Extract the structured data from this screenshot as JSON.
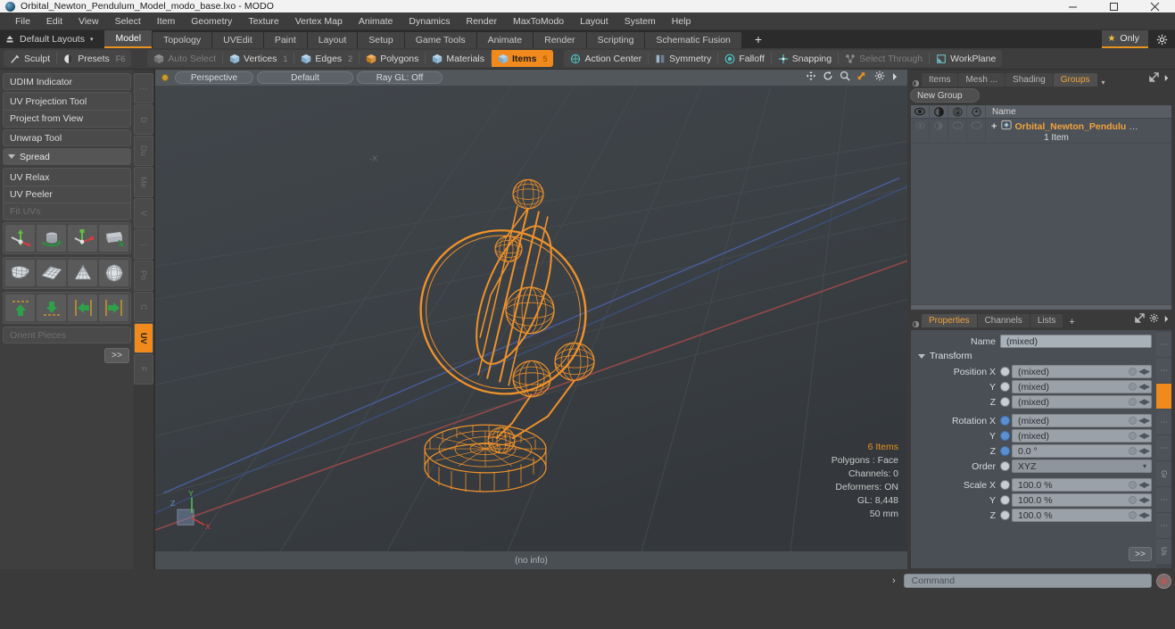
{
  "window": {
    "title": "Orbital_Newton_Pendulum_Model_modo_base.lxo - MODO",
    "app_icon": "modo-sphere-icon",
    "minimize": "–",
    "maximize": "□",
    "close": "✕"
  },
  "menubar": {
    "items": [
      "File",
      "Edit",
      "View",
      "Select",
      "Item",
      "Geometry",
      "Texture",
      "Vertex Map",
      "Animate",
      "Dynamics",
      "Render",
      "MaxToModo",
      "Layout",
      "System",
      "Help"
    ]
  },
  "layoutbar": {
    "layouts_label": "Default Layouts",
    "caret": "▾",
    "tabs": [
      "Model",
      "Topology",
      "UVEdit",
      "Paint",
      "Layout",
      "Setup",
      "Game Tools",
      "Animate",
      "Render",
      "Scripting",
      "Schematic Fusion"
    ],
    "active_tab": "Model",
    "plus": "+",
    "only_label": "Only",
    "star_icon": "star-icon",
    "gear_icon": "gear-icon"
  },
  "modebar": {
    "left_group": [
      {
        "label": "Sculpt",
        "icon": "brush-icon",
        "state": "normal"
      },
      {
        "label": "Presets",
        "icon": "sphere-half-icon",
        "state": "normal",
        "hint": "F6"
      }
    ],
    "selection_modes": [
      {
        "label": "Auto Select",
        "icon": "cube-grey-icon",
        "state": "dim",
        "count": ""
      },
      {
        "label": "Vertices",
        "icon": "cube-blue-icon",
        "state": "normal",
        "count": "1"
      },
      {
        "label": "Edges",
        "icon": "cube-blue-icon",
        "state": "normal",
        "count": "2"
      },
      {
        "label": "Polygons",
        "icon": "cube-orange-icon",
        "state": "normal",
        "count": ""
      },
      {
        "label": "Materials",
        "icon": "cube-blue-icon",
        "state": "normal",
        "count": ""
      },
      {
        "label": "Items",
        "icon": "cube-blue-icon",
        "state": "selected",
        "count": "5"
      }
    ],
    "tool_toggles": [
      {
        "label": "Action Center",
        "icon": "action-center-icon",
        "state": "normal"
      },
      {
        "label": "Symmetry",
        "icon": "symmetry-icon",
        "state": "normal"
      },
      {
        "label": "Falloff",
        "icon": "falloff-icon",
        "state": "normal"
      },
      {
        "label": "Snapping",
        "icon": "snapping-icon",
        "state": "normal"
      },
      {
        "label": "Select Through",
        "icon": "select-through-icon",
        "state": "dim"
      },
      {
        "label": "WorkPlane",
        "icon": "workplane-icon",
        "state": "normal"
      }
    ]
  },
  "left_panel": {
    "buttons": [
      {
        "label": "UDIM Indicator",
        "state": "normal"
      },
      {
        "label": "UV Projection Tool",
        "state": "normal"
      },
      {
        "label": "Project from View",
        "state": "normal"
      },
      {
        "label": "Unwrap Tool",
        "state": "normal"
      }
    ],
    "spread_header": "Spread",
    "group2": [
      {
        "label": "UV Relax",
        "state": "normal"
      },
      {
        "label": "UV Peeler",
        "state": "normal"
      },
      {
        "label": "Fit UVs",
        "state": "dim"
      }
    ],
    "icon_rows": [
      [
        "move-axis-icon",
        "rotate-cylinder-icon",
        "scale-axis-icon",
        "flip-book-icon"
      ],
      [
        "mesh-shell-icon",
        "mesh-grid-icon",
        "mesh-cone-icon",
        "mesh-sphere-icon"
      ],
      [
        "align-up-icon",
        "align-down-icon",
        "align-left-icon",
        "align-right-icon"
      ]
    ],
    "orient_pieces": "Orient Pieces",
    "more_button": ">>",
    "vtabs": [
      {
        "label": "⋮",
        "state": "dim"
      },
      {
        "label": "D",
        "state": "dim"
      },
      {
        "label": "Du",
        "state": "dim"
      },
      {
        "label": "Me",
        "state": "dim"
      },
      {
        "label": "V",
        "state": "dim"
      },
      {
        "label": "⋮",
        "state": "dim"
      },
      {
        "label": "Po",
        "state": "dim"
      },
      {
        "label": "C",
        "state": "dim"
      },
      {
        "label": "UV",
        "state": "active"
      },
      {
        "label": "F",
        "state": "dim"
      }
    ]
  },
  "viewport": {
    "header": {
      "view_mode": "Perspective",
      "shading": "Default",
      "ray_gl": "Ray GL: Off",
      "tools": [
        "pan-icon",
        "rotate-icon",
        "zoom-icon",
        "fit-icon",
        "gear-icon",
        "chevron-right-icon"
      ]
    },
    "stats": {
      "items": "6 Items",
      "polygons": "Polygons : Face",
      "channels": "Channels: 0",
      "deformers": "Deformers: ON",
      "gl": "GL: 8,448",
      "grid": "50 mm"
    },
    "axis_gizmo": {
      "x": "X",
      "y": "Y",
      "z": "Z"
    },
    "model_name": "orbital-newton-pendulum-wireframe",
    "wireframe_color": "#f0922a"
  },
  "status_bar": {
    "text": "(no info)"
  },
  "right_panel": {
    "top": {
      "tabs": [
        "Items",
        "Mesh ...",
        "Shading",
        "Groups"
      ],
      "active_tab": "Groups",
      "caret": "▾",
      "expand_icon": "expand-icon",
      "chevron_icon": "chevron-right-icon",
      "new_group_button": "New Group",
      "tree_columns": [
        "visibility-icon",
        "render-icon",
        "lock-icon",
        "wireframe-icon",
        "Name"
      ],
      "rows": [
        {
          "name": "Orbital_Newton_Pendulu",
          "ellipsis": "…",
          "sub": "1 Item",
          "icon": "group-icon",
          "plus": "+"
        }
      ]
    },
    "bottom": {
      "tabs": [
        "Properties",
        "Channels",
        "Lists"
      ],
      "active_tab": "Properties",
      "plus": "+",
      "expand_icon": "expand-icon",
      "gear_icon": "gear-icon",
      "chevron_icon": "chevron-right-icon",
      "name_label": "Name",
      "name_value": "(mixed)",
      "transform_header": "Transform",
      "fields": [
        {
          "label": "Position X",
          "value": "(mixed)",
          "radio": "grey"
        },
        {
          "label": "Y",
          "value": "(mixed)",
          "radio": "grey"
        },
        {
          "label": "Z",
          "value": "(mixed)",
          "radio": "grey"
        },
        {
          "label": "Rotation X",
          "value": "(mixed)",
          "radio": "blue"
        },
        {
          "label": "Y",
          "value": "(mixed)",
          "radio": "blue"
        },
        {
          "label": "Z",
          "value": "0.0 °",
          "radio": "blue"
        },
        {
          "label": "Order",
          "value": "XYZ",
          "radio": "grey",
          "dropdown": true
        },
        {
          "label": "Scale X",
          "value": "100.0 %",
          "radio": "grey"
        },
        {
          "label": "Y",
          "value": "100.0 %",
          "radio": "grey"
        },
        {
          "label": "Z",
          "value": "100.0 %",
          "radio": "grey"
        }
      ],
      "more_button": ">>",
      "vtabs": [
        {
          "label": "⋮",
          "state": "dim"
        },
        {
          "label": "⋮",
          "state": "dim"
        },
        {
          "label": "",
          "state": "active"
        },
        {
          "label": "⋮",
          "state": "dim"
        },
        {
          "label": "⋮",
          "state": "dim"
        },
        {
          "label": "Gr",
          "state": "dim"
        },
        {
          "label": "⋮",
          "state": "dim"
        },
        {
          "label": "⋮",
          "state": "dim"
        },
        {
          "label": "Us",
          "state": "dim"
        }
      ]
    }
  },
  "command_bar": {
    "prompt": "›",
    "placeholder": "Command",
    "value": "",
    "record_icon": "record-icon"
  },
  "colors": {
    "accent": "#f08a1c",
    "wireframe": "#f0922a",
    "panel_bg": "#3a3a3a",
    "viewport_bg": "#3c4145"
  }
}
